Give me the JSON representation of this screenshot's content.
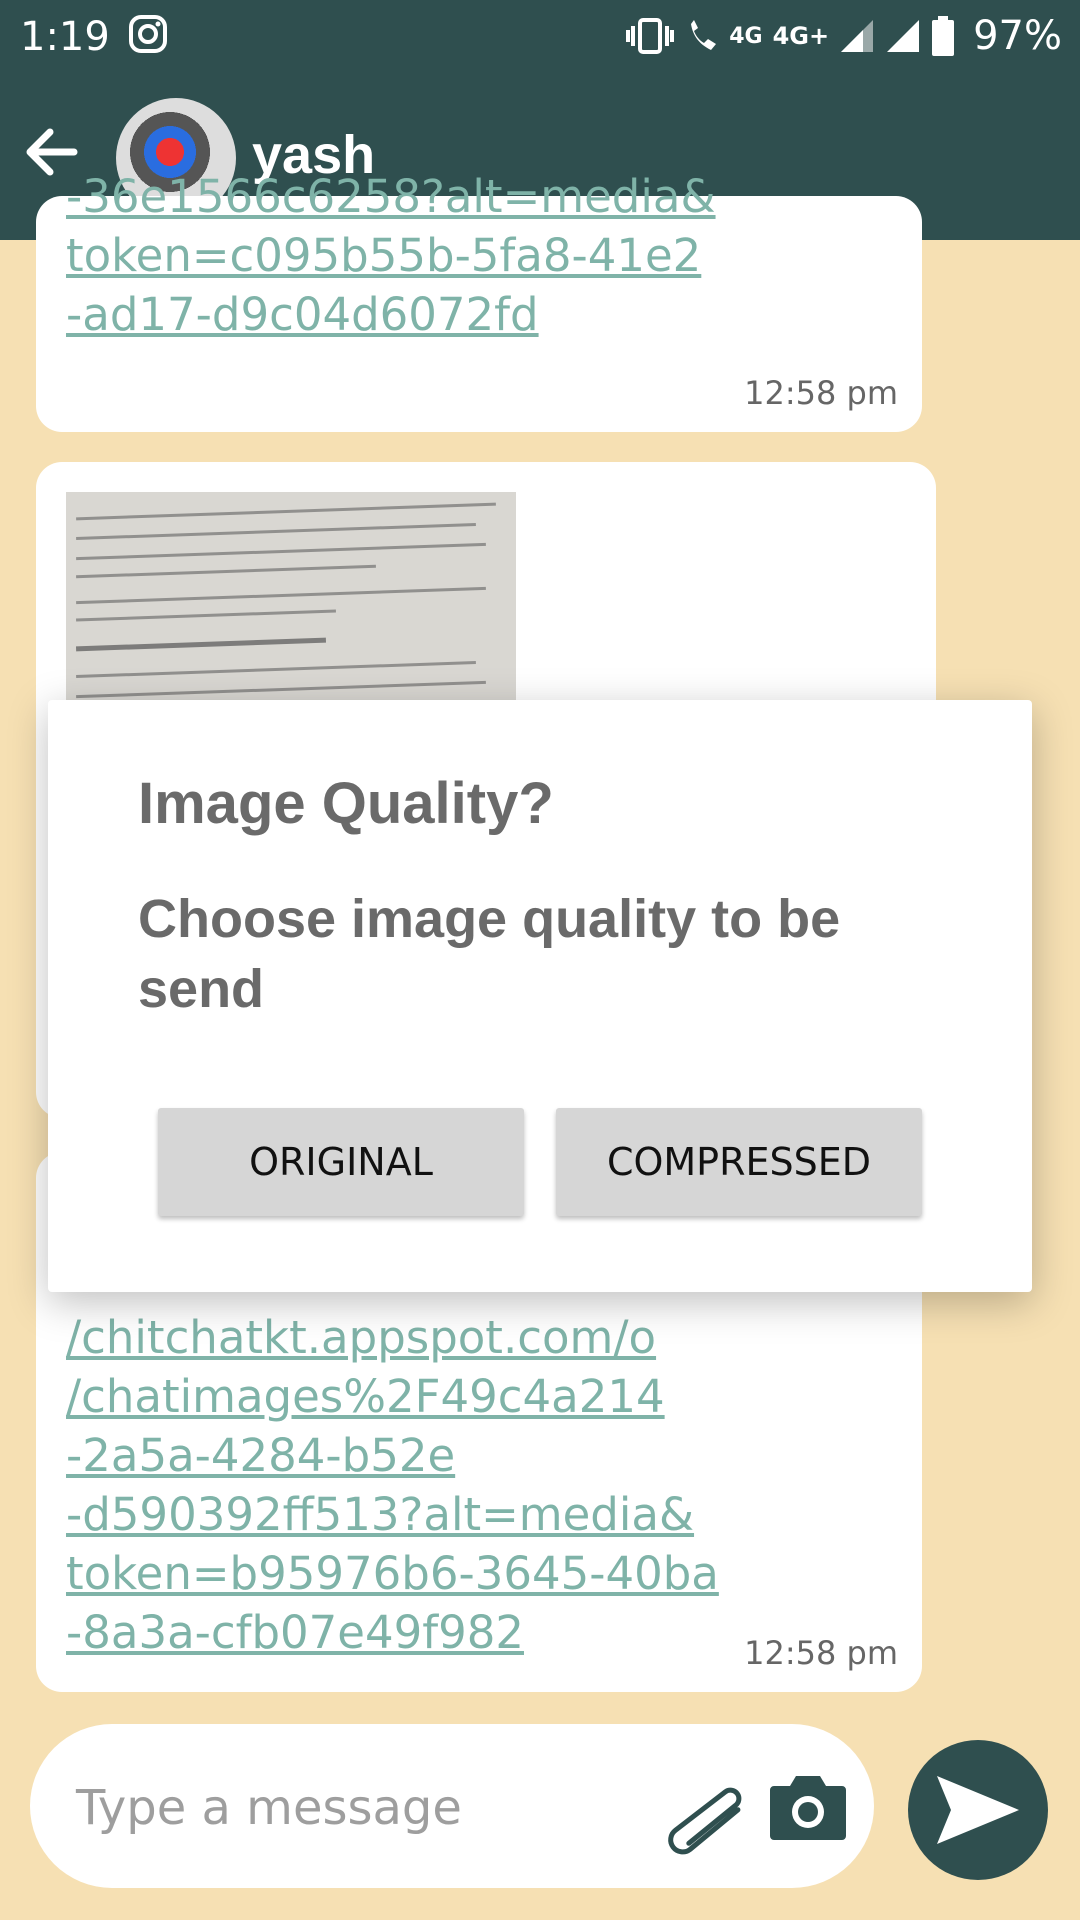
{
  "status_bar": {
    "time": "1:19",
    "network_4g_small": "4G",
    "network_4g_plus": "4G+",
    "battery": "97%"
  },
  "header": {
    "contact_name": "yash"
  },
  "messages": [
    {
      "type": "link",
      "text": "-36e1566c6258?alt=media&\ntoken=c095b55b-5fa8-41e2\n-ad17-d9c04d6072fd",
      "time": "12:58 pm"
    },
    {
      "type": "image"
    },
    {
      "type": "link",
      "text": "/chitchatkt.appspot.com/o\n/chatimages%2F49c4a214\n-2a5a-4284-b52e\n-d590392ff513?alt=media&\ntoken=b95976b6-3645-40ba\n-8a3a-cfb07e49f982",
      "time": "12:58 pm"
    }
  ],
  "dialog": {
    "title": "Image Quality?",
    "message": "Choose image quality to be send",
    "button_original": "ORIGINAL",
    "button_compressed": "COMPRESSED"
  },
  "composer": {
    "placeholder": "Type a message"
  },
  "colors": {
    "header": "#2f4f4f",
    "background": "#f6e0b3",
    "link": "#7fb3a8"
  }
}
